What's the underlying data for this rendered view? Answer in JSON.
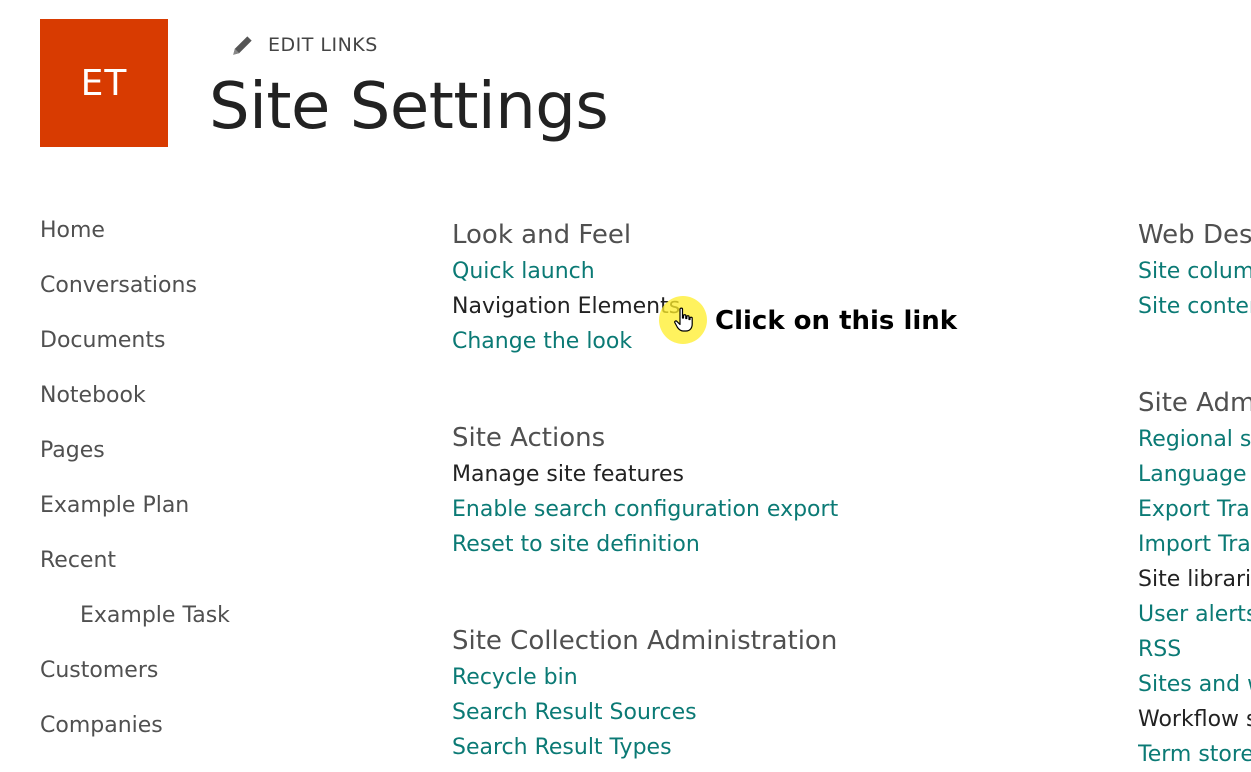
{
  "header": {
    "logo_text": "ET",
    "logo_color": "#d83b01",
    "edit_links_label": "EDIT LINKS",
    "edit_icon": "pencil-icon",
    "title": "Site Settings"
  },
  "quick_launch": {
    "items": [
      {
        "label": "Home"
      },
      {
        "label": "Conversations"
      },
      {
        "label": "Documents"
      },
      {
        "label": "Notebook"
      },
      {
        "label": "Pages"
      },
      {
        "label": "Example Plan"
      },
      {
        "label": "Recent"
      },
      {
        "label": "Example Task"
      },
      {
        "label": "Customers"
      },
      {
        "label": "Companies"
      }
    ]
  },
  "sections": {
    "look_and_feel": {
      "title": "Look and Feel",
      "links": [
        "Quick launch",
        "Navigation Elements",
        "Change the look"
      ]
    },
    "site_actions": {
      "title": "Site Actions",
      "links": [
        "Manage site features",
        "Enable search configuration export",
        "Reset to site definition"
      ]
    },
    "site_collection_admin": {
      "title": "Site Collection Administration",
      "links": [
        "Recycle bin",
        "Search Result Sources",
        "Search Result Types"
      ]
    },
    "web_designer": {
      "title": "Web Designer Galleries",
      "links": [
        "Site columns",
        "Site content types"
      ]
    },
    "site_admin": {
      "title": "Site Administration",
      "links": [
        "Regional settings",
        "Language settings",
        "Export Translations",
        "Import Translations",
        "Site libraries and lists",
        "User alerts",
        "RSS",
        "Sites and workspaces",
        "Workflow settings",
        "Term store management"
      ]
    }
  },
  "annotation": {
    "text": "Click on this link",
    "highlight_color": "#ffee28",
    "cursor_icon": "hand-pointer-icon"
  },
  "colors": {
    "link": "#0b7a75",
    "text": "#505050"
  }
}
